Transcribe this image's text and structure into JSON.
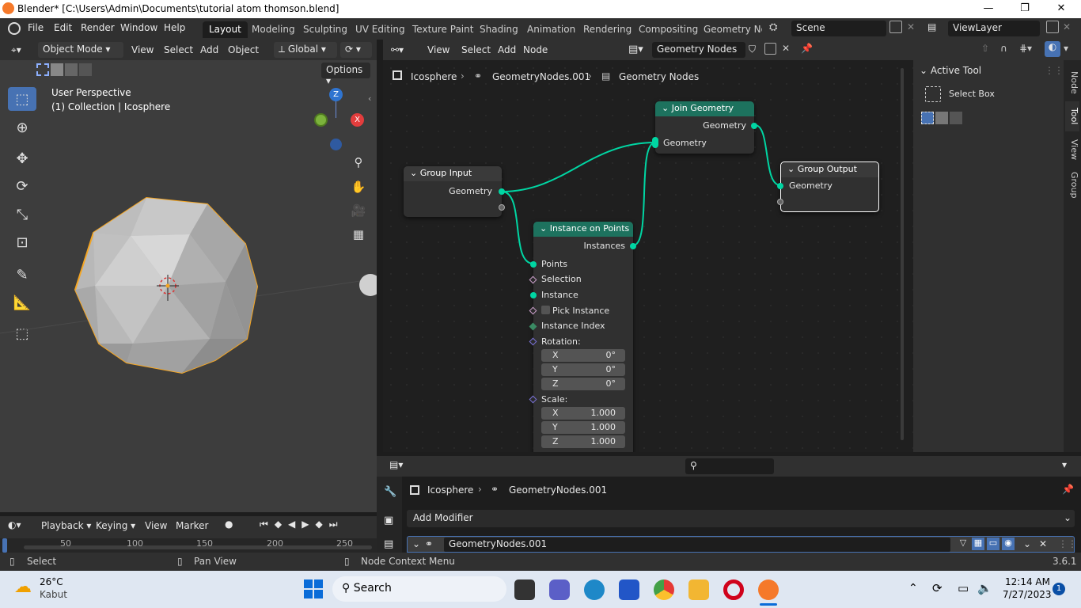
{
  "window": {
    "title": "Blender* [C:\\Users\\Admin\\Documents\\tutorial atom thomson.blend]"
  },
  "menu": [
    "File",
    "Edit",
    "Render",
    "Window",
    "Help"
  ],
  "workspaces": [
    "Layout",
    "Modeling",
    "Sculpting",
    "UV Editing",
    "Texture Paint",
    "Shading",
    "Animation",
    "Rendering",
    "Compositing",
    "Geometry Noc"
  ],
  "scene": "Scene",
  "view_layer": "ViewLayer",
  "viewport": {
    "mode": "Object Mode",
    "menus": [
      "View",
      "Select",
      "Add",
      "Object"
    ],
    "orientation": "Global",
    "options": "Options",
    "perspective": "User Perspective",
    "collection": "(1) Collection | Icosphere",
    "axis_z": "Z",
    "axis_x": "X"
  },
  "node_editor": {
    "menus": [
      "View",
      "Select",
      "Add",
      "Node"
    ],
    "tree_name": "Geometry Nodes",
    "breadcrumb": [
      "Icosphere",
      "GeometryNodes.001",
      "Geometry Nodes"
    ],
    "nodes": {
      "group_input": {
        "title": "Group Input",
        "out": "Geometry"
      },
      "join": {
        "title": "Join Geometry",
        "out": "Geometry",
        "in": "Geometry"
      },
      "group_output": {
        "title": "Group Output",
        "in": "Geometry"
      },
      "iop": {
        "title": "Instance on Points",
        "out": "Instances",
        "points": "Points",
        "selection": "Selection",
        "instance": "Instance",
        "pick": "Pick Instance",
        "index": "Instance Index",
        "rotation": "Rotation:",
        "rot": [
          {
            "axis": "X",
            "val": "0°"
          },
          {
            "axis": "Y",
            "val": "0°"
          },
          {
            "axis": "Z",
            "val": "0°"
          }
        ],
        "scale": "Scale:",
        "scl": [
          {
            "axis": "X",
            "val": "1.000"
          },
          {
            "axis": "Y",
            "val": "1.000"
          },
          {
            "axis": "Z",
            "val": "1.000"
          }
        ]
      }
    }
  },
  "sidebar": {
    "panel": "Active Tool",
    "tool": "Select Box",
    "tabs": [
      "Node",
      "Tool",
      "View",
      "Group"
    ]
  },
  "properties": {
    "breadcrumb": [
      "Icosphere",
      "GeometryNodes.001"
    ],
    "add_modifier": "Add Modifier",
    "modifier_name": "GeometryNodes.001"
  },
  "timeline": {
    "menus": [
      "Playback",
      "Keying",
      "View",
      "Marker"
    ],
    "ticks": [
      "50",
      "100",
      "150",
      "200",
      "250"
    ]
  },
  "status": {
    "left": "Select",
    "mid": "Pan View",
    "right": "Node Context Menu",
    "version": "3.6.1"
  },
  "taskbar": {
    "temp": "26°C",
    "weather": "Kabut",
    "search": "Search",
    "time": "12:14 AM",
    "date": "7/27/2023",
    "notif": "1"
  },
  "colors": {
    "accent": "#4772b3",
    "socket_geo": "#00d6a3",
    "node_geo_header": "#1d725e",
    "selection_orange": "#f5a623"
  }
}
